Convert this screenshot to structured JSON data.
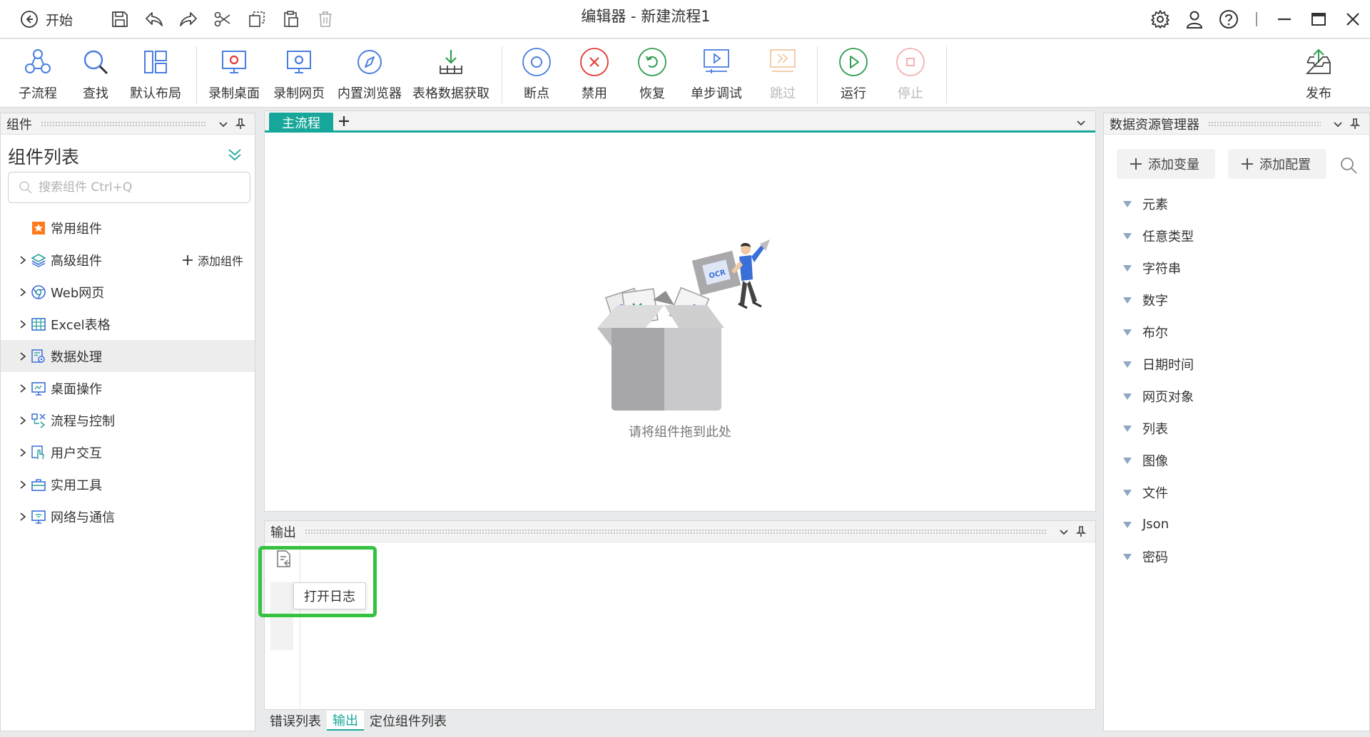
{
  "window": {
    "title": "编辑器 - 新建流程1",
    "start_label": "开始"
  },
  "quick_access": [
    "save-icon",
    "undo-icon",
    "redo-icon",
    "cut-icon",
    "copy-icon",
    "paste-icon",
    "delete-icon"
  ],
  "ribbon": {
    "subflow": "子流程",
    "find": "查找",
    "default_layout": "默认布局",
    "record_desktop": "录制桌面",
    "record_web": "录制网页",
    "builtin_browser": "内置浏览器",
    "table_fetch": "表格数据获取",
    "breakpoint": "断点",
    "disable": "禁用",
    "restore": "恢复",
    "step_debug": "单步调试",
    "skip": "跳过",
    "run": "运行",
    "stop": "停止",
    "publish": "发布"
  },
  "left_panel": {
    "header": "组件",
    "title": "组件列表",
    "search_placeholder": "搜索组件 Ctrl+Q",
    "add_component": "添加组件",
    "items": [
      {
        "label": "常用组件",
        "icon": "star-icon"
      },
      {
        "label": "高级组件",
        "icon": "layers-icon"
      },
      {
        "label": "Web网页",
        "icon": "browser-icon"
      },
      {
        "label": "Excel表格",
        "icon": "excel-icon"
      },
      {
        "label": "数据处理",
        "icon": "data-process-icon"
      },
      {
        "label": "桌面操作",
        "icon": "monitor-icon"
      },
      {
        "label": "流程与控制",
        "icon": "flow-control-icon"
      },
      {
        "label": "用户交互",
        "icon": "touch-icon"
      },
      {
        "label": "实用工具",
        "icon": "toolbox-icon"
      },
      {
        "label": "网络与通信",
        "icon": "network-icon"
      }
    ]
  },
  "canvas": {
    "tab": "主流程",
    "empty_text": "请将组件拖到此处",
    "illustration_text": "OCR"
  },
  "output": {
    "header": "输出",
    "tooltip": "打开日志"
  },
  "bottom_tabs": {
    "errors": "错误列表",
    "output": "输出",
    "locate": "定位组件列表"
  },
  "right_panel": {
    "header": "数据资源管理器",
    "add_variable": "添加变量",
    "add_config": "添加配置",
    "types": [
      "元素",
      "任意类型",
      "字符串",
      "数字",
      "布尔",
      "日期时间",
      "网页对象",
      "列表",
      "图像",
      "文件",
      "Json",
      "密码"
    ]
  },
  "colors": {
    "accent": "#17a79a",
    "highlight": "#36c241",
    "record": "#e53935",
    "blue": "#3a6fd8",
    "green": "#2e9e4f"
  }
}
